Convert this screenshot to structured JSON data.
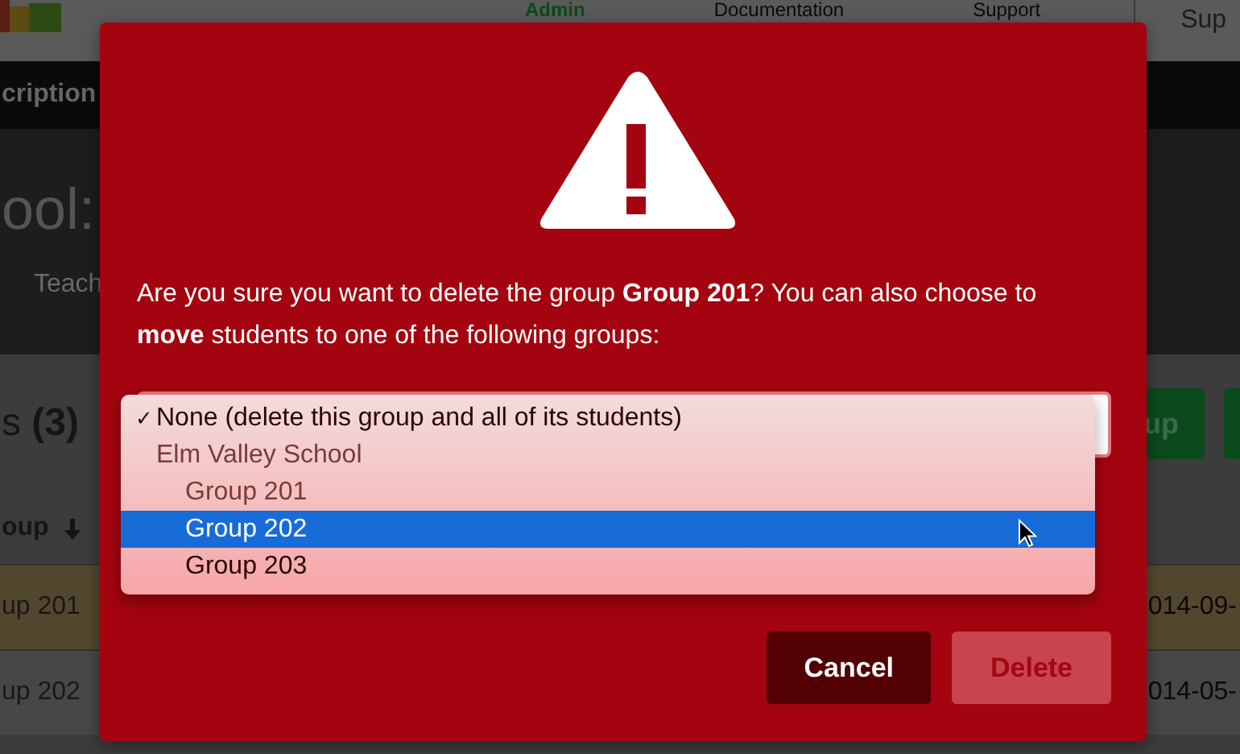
{
  "background": {
    "nav": [
      {
        "label": "Admin",
        "selected": true
      },
      {
        "label": "Documentation",
        "selected": false
      },
      {
        "label": "Support",
        "selected": false
      }
    ],
    "account": "Sup",
    "subnav": "cription",
    "title": "ool:",
    "tab": "Teach",
    "section_title": "s **(3)**",
    "add_button": "up",
    "table_header": "oup",
    "rows": [
      {
        "name": "up 201",
        "date": "014-09-",
        "selected": true
      },
      {
        "name": "up 202",
        "date": "014-05-",
        "selected": false
      }
    ]
  },
  "dialog": {
    "message": "Are you sure you want to delete the group **Group 201**? You can also choose to **move** students to one of the following groups:",
    "check_glyph": "✓",
    "options": [
      {
        "kind": "option",
        "label": "None (delete this group and all of its students)",
        "checked": true,
        "selected": false
      },
      {
        "kind": "group",
        "label": "Elm Valley School",
        "children": [
          {
            "kind": "option",
            "label": "Group 201",
            "checked": false,
            "selected": false,
            "disabled": true
          },
          {
            "kind": "option",
            "label": "Group 202",
            "checked": false,
            "selected": true,
            "disabled": false
          },
          {
            "kind": "option",
            "label": "Group 203",
            "checked": false,
            "selected": false,
            "disabled": false
          }
        ]
      }
    ],
    "buttons": [
      {
        "label": "Cancel",
        "kind": "secondary",
        "disabled": false
      },
      {
        "label": "Delete",
        "kind": "danger",
        "disabled": true
      }
    ]
  }
}
